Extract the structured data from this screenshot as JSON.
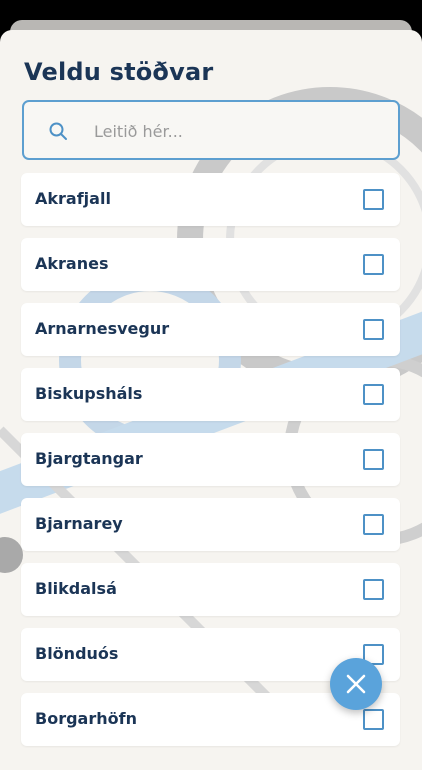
{
  "sheet": {
    "title": "Veldu stöðvar"
  },
  "search": {
    "placeholder": "Leitið hér...",
    "value": "",
    "icon": "search-icon"
  },
  "stations": [
    {
      "label": "Akrafjall",
      "checked": false
    },
    {
      "label": "Akranes",
      "checked": false
    },
    {
      "label": "Arnarnesvegur",
      "checked": false
    },
    {
      "label": "Biskupsháls",
      "checked": false
    },
    {
      "label": "Bjargtangar",
      "checked": false
    },
    {
      "label": "Bjarnarey",
      "checked": false
    },
    {
      "label": "Blikdalsá",
      "checked": false
    },
    {
      "label": "Blönduós",
      "checked": false
    },
    {
      "label": "Borgarhöfn",
      "checked": false
    }
  ],
  "fab": {
    "icon": "close-icon"
  },
  "colors": {
    "accent": "#5aa3db",
    "title": "#1b3556",
    "background": "#f6f4f0"
  }
}
